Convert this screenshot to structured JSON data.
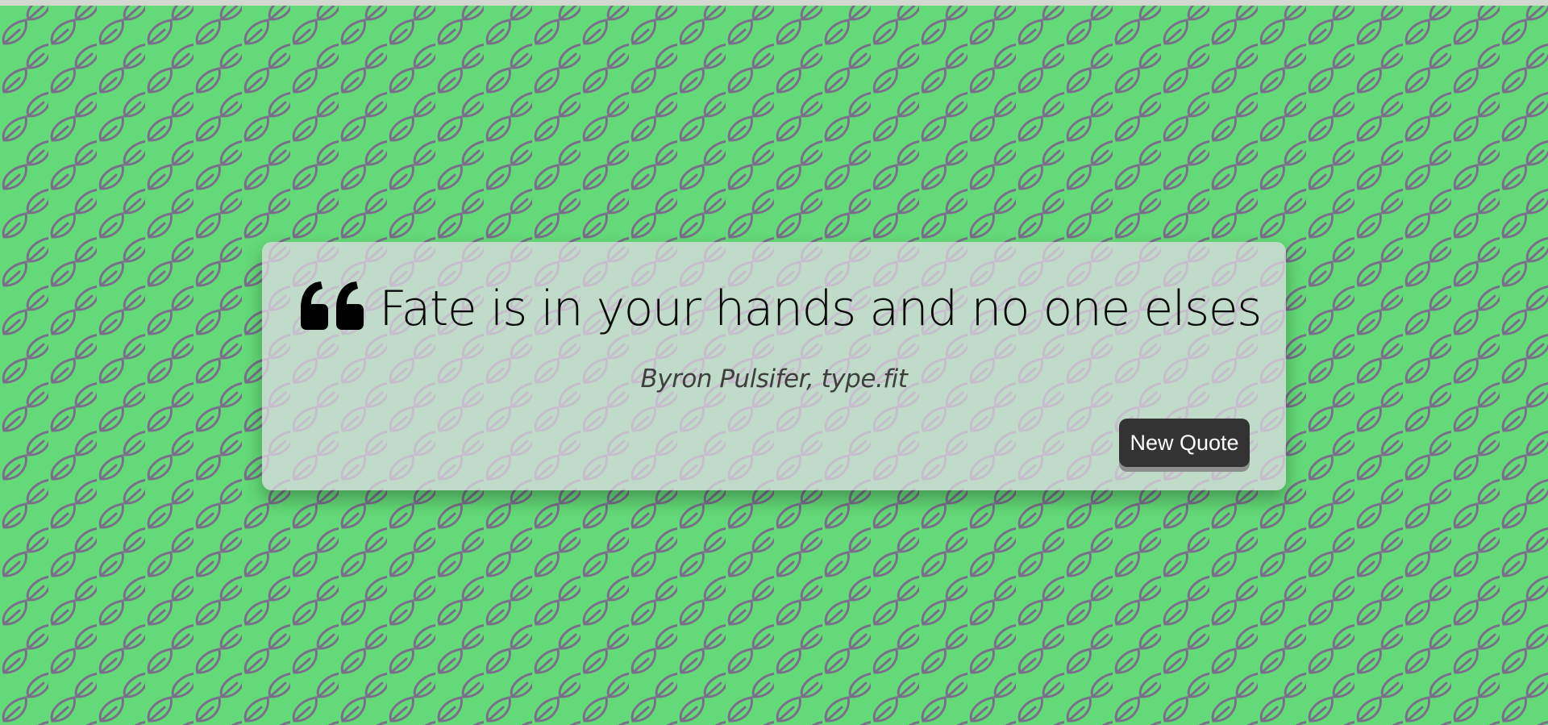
{
  "page": {
    "background_color": "#63d977",
    "pattern_icon": "leaf-icon",
    "pattern_color": "#7a6e8c"
  },
  "quote": {
    "icon": "quote-open-icon",
    "text": "Fate is in your hands and no one elses",
    "author": "Byron Pulsifer, type.fit"
  },
  "actions": {
    "new_quote_label": "New Quote",
    "button_color": "#333333"
  }
}
